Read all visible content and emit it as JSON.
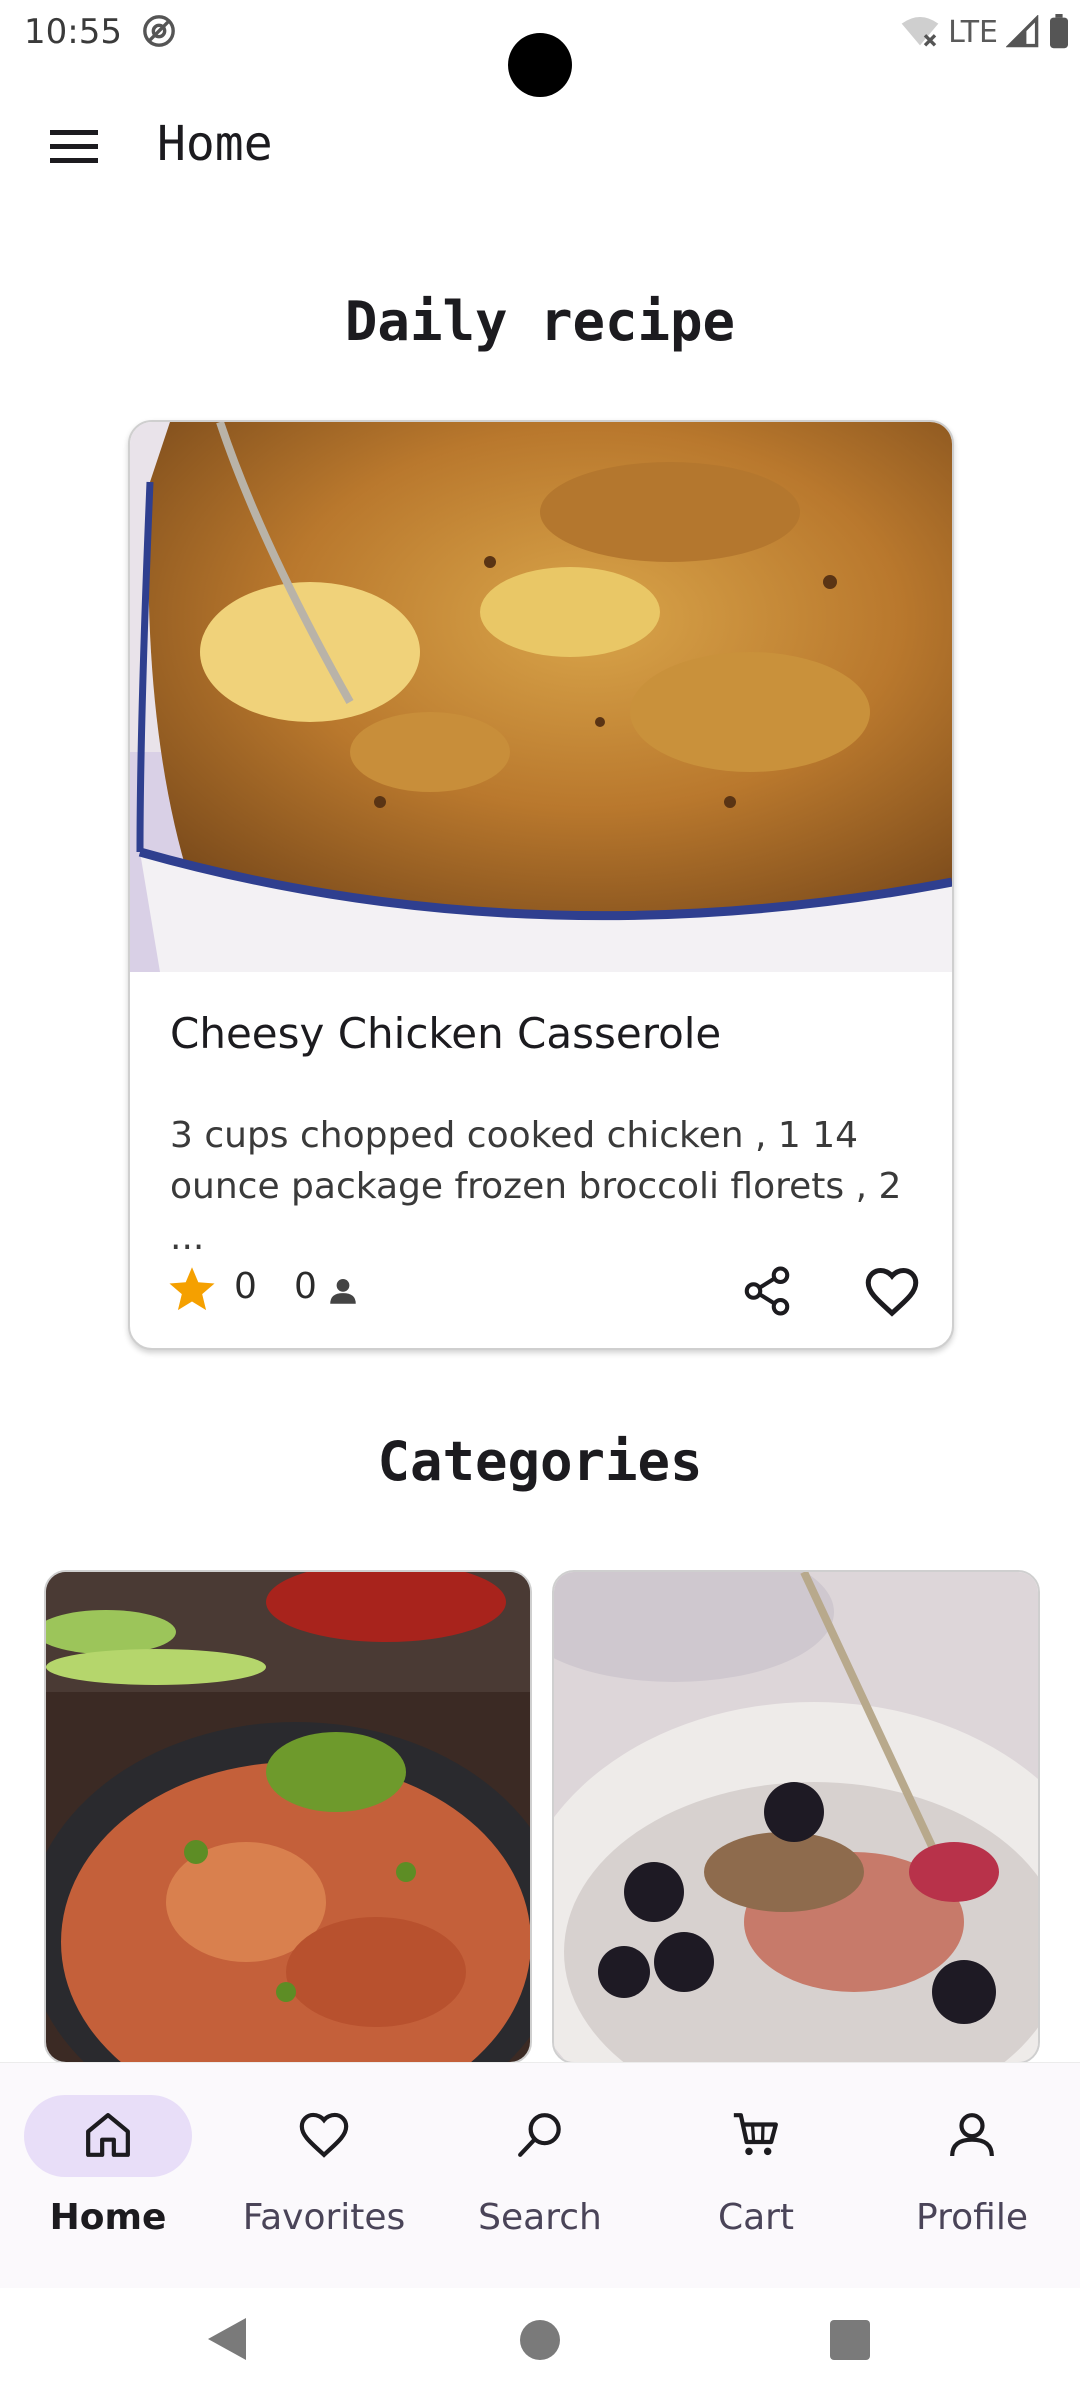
{
  "status_bar": {
    "time": "10:55",
    "network": "LTE",
    "icons": [
      "at-sign-icon",
      "wifi-off-icon",
      "signal-icon",
      "battery-icon"
    ]
  },
  "app_bar": {
    "menu_icon": "hamburger-menu-icon",
    "title": "Home"
  },
  "daily_recipe": {
    "section_title": "Daily recipe",
    "recipe": {
      "image": "casserole-photo",
      "name": "Cheesy Chicken Casserole",
      "description": "3 cups chopped cooked chicken , 1 14 ounce package frozen broccoli florets , 2 ...",
      "rating_count": "0",
      "servings_count": "0",
      "icons": [
        "star-icon",
        "person-icon",
        "share-icon",
        "heart-outline-icon"
      ]
    }
  },
  "categories": {
    "section_title": "Categories",
    "items": [
      {
        "image": "chicken-rice-dish-photo"
      },
      {
        "image": "berry-granola-bowl-photo"
      }
    ]
  },
  "bottom_nav": {
    "items": [
      {
        "label": "Home",
        "icon": "home-icon",
        "active": true
      },
      {
        "label": "Favorites",
        "icon": "heart-outline-icon",
        "active": false
      },
      {
        "label": "Search",
        "icon": "search-icon",
        "active": false
      },
      {
        "label": "Cart",
        "icon": "cart-icon",
        "active": false
      },
      {
        "label": "Profile",
        "icon": "person-outline-icon",
        "active": false
      }
    ]
  },
  "colors": {
    "accent_star": "#f5a000",
    "nav_active_pill": "#e8def8",
    "text_primary": "#1c1b1f"
  }
}
